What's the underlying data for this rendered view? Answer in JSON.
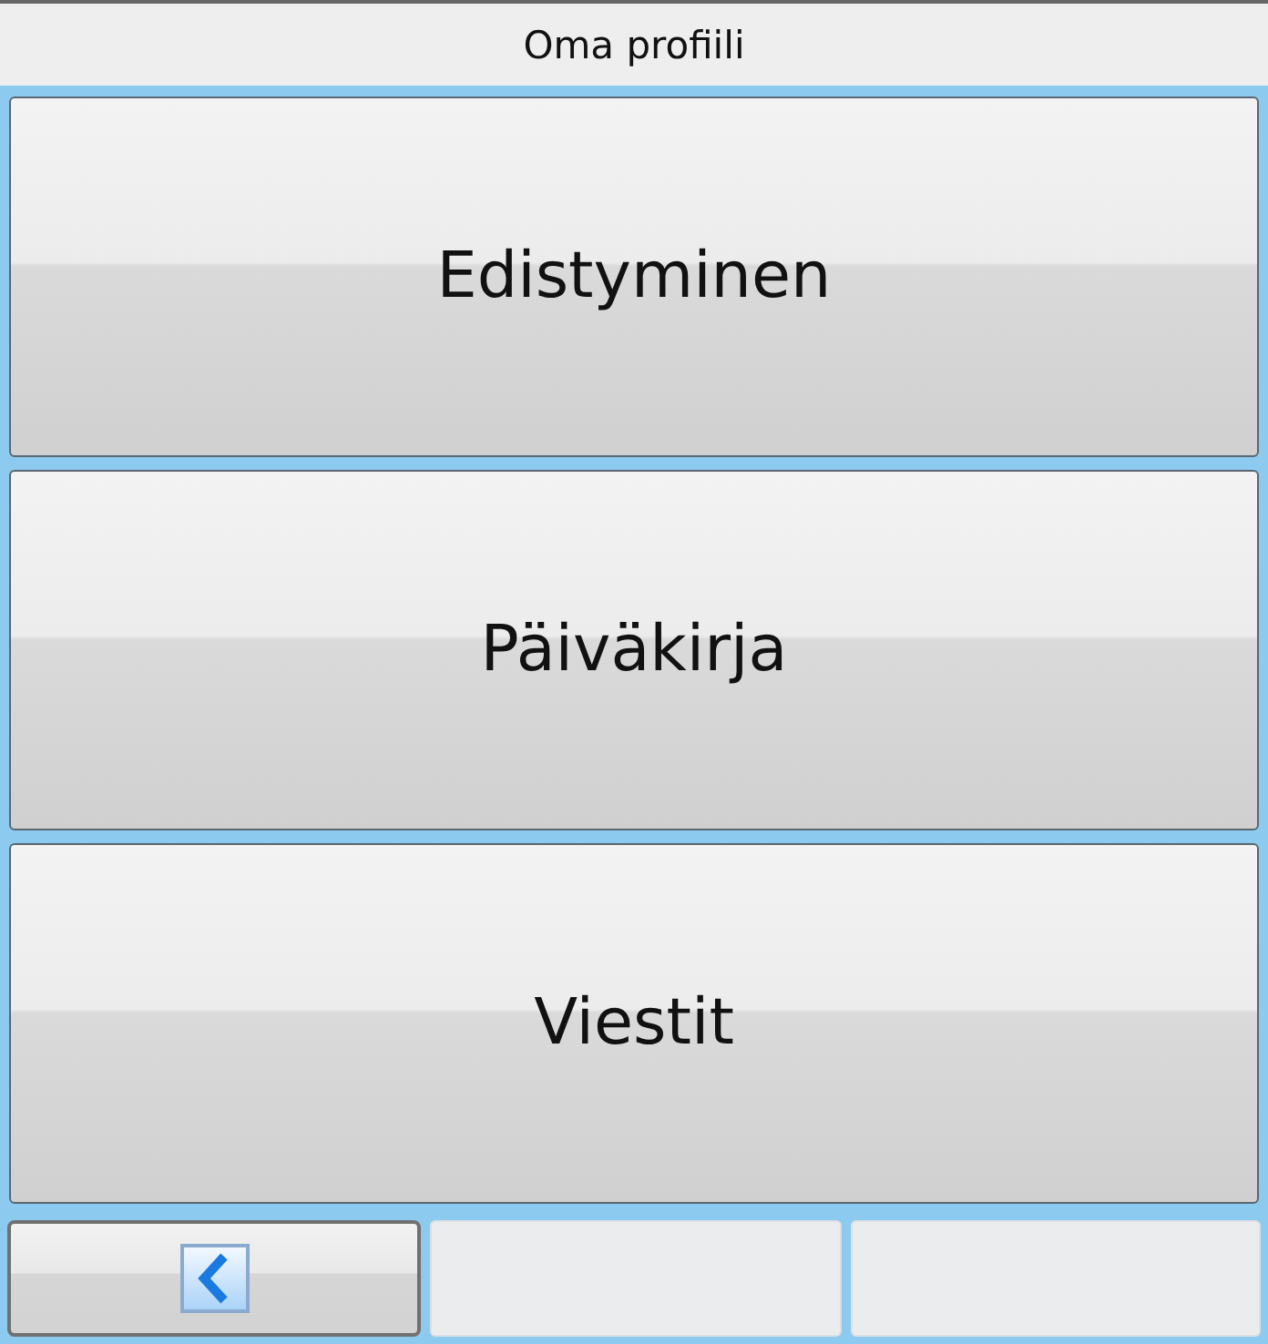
{
  "header": {
    "title": "Oma profiili"
  },
  "menu_buttons": [
    {
      "label": "Edistyminen"
    },
    {
      "label": "Päiväkirja"
    },
    {
      "label": "Viestit"
    }
  ],
  "footer_slots": [
    {
      "kind": "back"
    },
    {
      "kind": "empty"
    },
    {
      "kind": "empty"
    }
  ]
}
